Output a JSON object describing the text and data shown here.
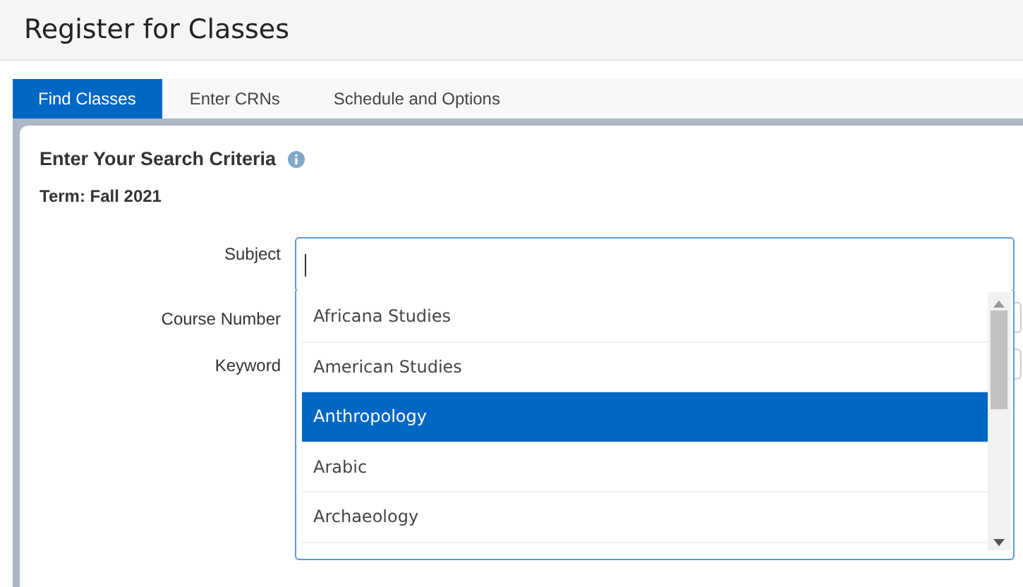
{
  "page": {
    "title": "Register for Classes"
  },
  "tabs": [
    {
      "label": "Find Classes",
      "selected": true
    },
    {
      "label": "Enter CRNs",
      "selected": false
    },
    {
      "label": "Schedule and Options",
      "selected": false
    }
  ],
  "search": {
    "heading": "Enter Your Search Criteria",
    "term": "Term: Fall 2021",
    "fields": [
      {
        "label": "Subject",
        "kind": "combo"
      },
      {
        "label": "Course Number",
        "kind": "text"
      },
      {
        "label": "Keyword",
        "kind": "text"
      }
    ],
    "subject_options": [
      {
        "label": "Africana Studies",
        "selected": false
      },
      {
        "label": "American Studies",
        "selected": false
      },
      {
        "label": "Anthropology",
        "selected": true
      },
      {
        "label": "Arabic",
        "selected": false
      },
      {
        "label": "Archaeology",
        "selected": false
      }
    ]
  }
}
